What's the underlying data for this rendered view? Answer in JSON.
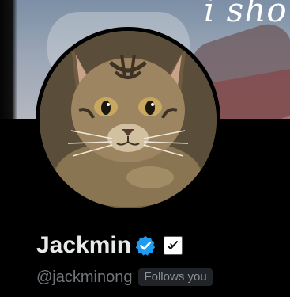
{
  "banner": {
    "overlay_text": "i sho"
  },
  "profile": {
    "display_name": "Jackmin",
    "handle": "@jackminong",
    "follows_you_label": "Follows you"
  },
  "icons": {
    "verified": "verified-badge-icon",
    "affiliate": "affiliate-badge-icon"
  },
  "colors": {
    "background": "#000000",
    "name": "#e7e9ea",
    "handle": "#71767b",
    "verified_blue": "#1d9bf0",
    "follows_badge_bg": "#202327"
  }
}
